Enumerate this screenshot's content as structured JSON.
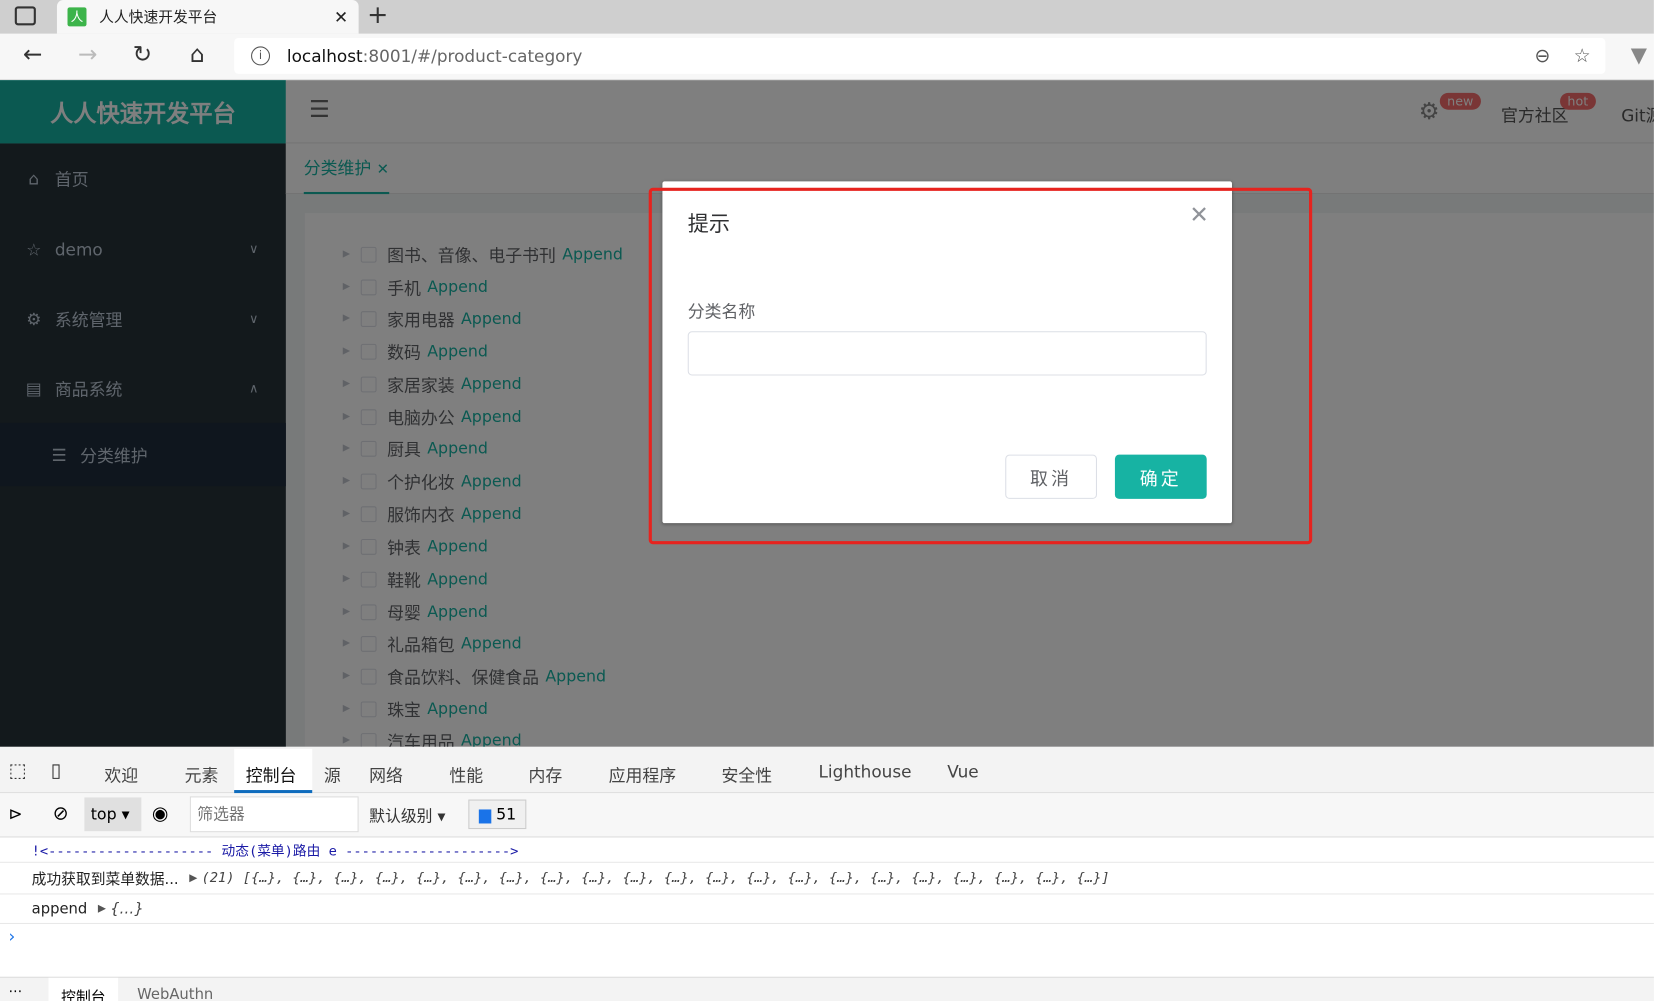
{
  "browser": {
    "tab_title": "人人快速开发平台",
    "url_host": "localhost",
    "url_rest": ":8001/#/product-category"
  },
  "app": {
    "logo": "人人快速开发平台",
    "header": {
      "new_badge": "new",
      "community": "官方社区",
      "hot_badge": "hot",
      "git": "Git源"
    },
    "sidebar": [
      {
        "label": "首页",
        "icon": "home-icon"
      },
      {
        "label": "demo",
        "icon": "star-icon"
      },
      {
        "label": "系统管理",
        "icon": "gear-icon"
      },
      {
        "label": "商品系统",
        "icon": "product-icon"
      },
      {
        "label": "分类维护",
        "icon": "list-icon"
      }
    ],
    "page_tab": "分类维护",
    "append_label": "Append",
    "tree": [
      "图书、音像、电子书刊",
      "手机",
      "家用电器",
      "数码",
      "家居家装",
      "电脑办公",
      "厨具",
      "个护化妆",
      "服饰内衣",
      "钟表",
      "鞋靴",
      "母婴",
      "礼品箱包",
      "食品饮料、保健食品",
      "珠宝",
      "汽车用品"
    ]
  },
  "dialog": {
    "title": "提示",
    "label": "分类名称",
    "input_value": "",
    "cancel": "取消",
    "ok": "确定"
  },
  "devtools": {
    "tabs": [
      "欢迎",
      "元素",
      "控制台",
      "源",
      "网络",
      "性能",
      "内存",
      "应用程序",
      "安全性",
      "Lighthouse",
      "Vue"
    ],
    "active_tab": "控制台",
    "context": "top",
    "filter_placeholder": "筛选器",
    "level": "默认级别",
    "message_count": "51",
    "console": [
      "!<-------------------- 动态(菜单)路由 e -------------------->",
      "成功获取到菜单数据...",
      "(21) [{…}, {…}, {…}, {…}, {…}, {…}, {…}, {…}, {…}, {…}, {…}, {…}, {…}, {…}, {…}, {…}, {…}, {…}, {…}, {…}, {…}]",
      "append",
      "{…}"
    ],
    "drawer_tabs": [
      "控制台",
      "WebAuthn"
    ]
  },
  "colors": {
    "accent": "#17b3a3",
    "sidebar": "#263238",
    "highlight": "#e6231e"
  }
}
